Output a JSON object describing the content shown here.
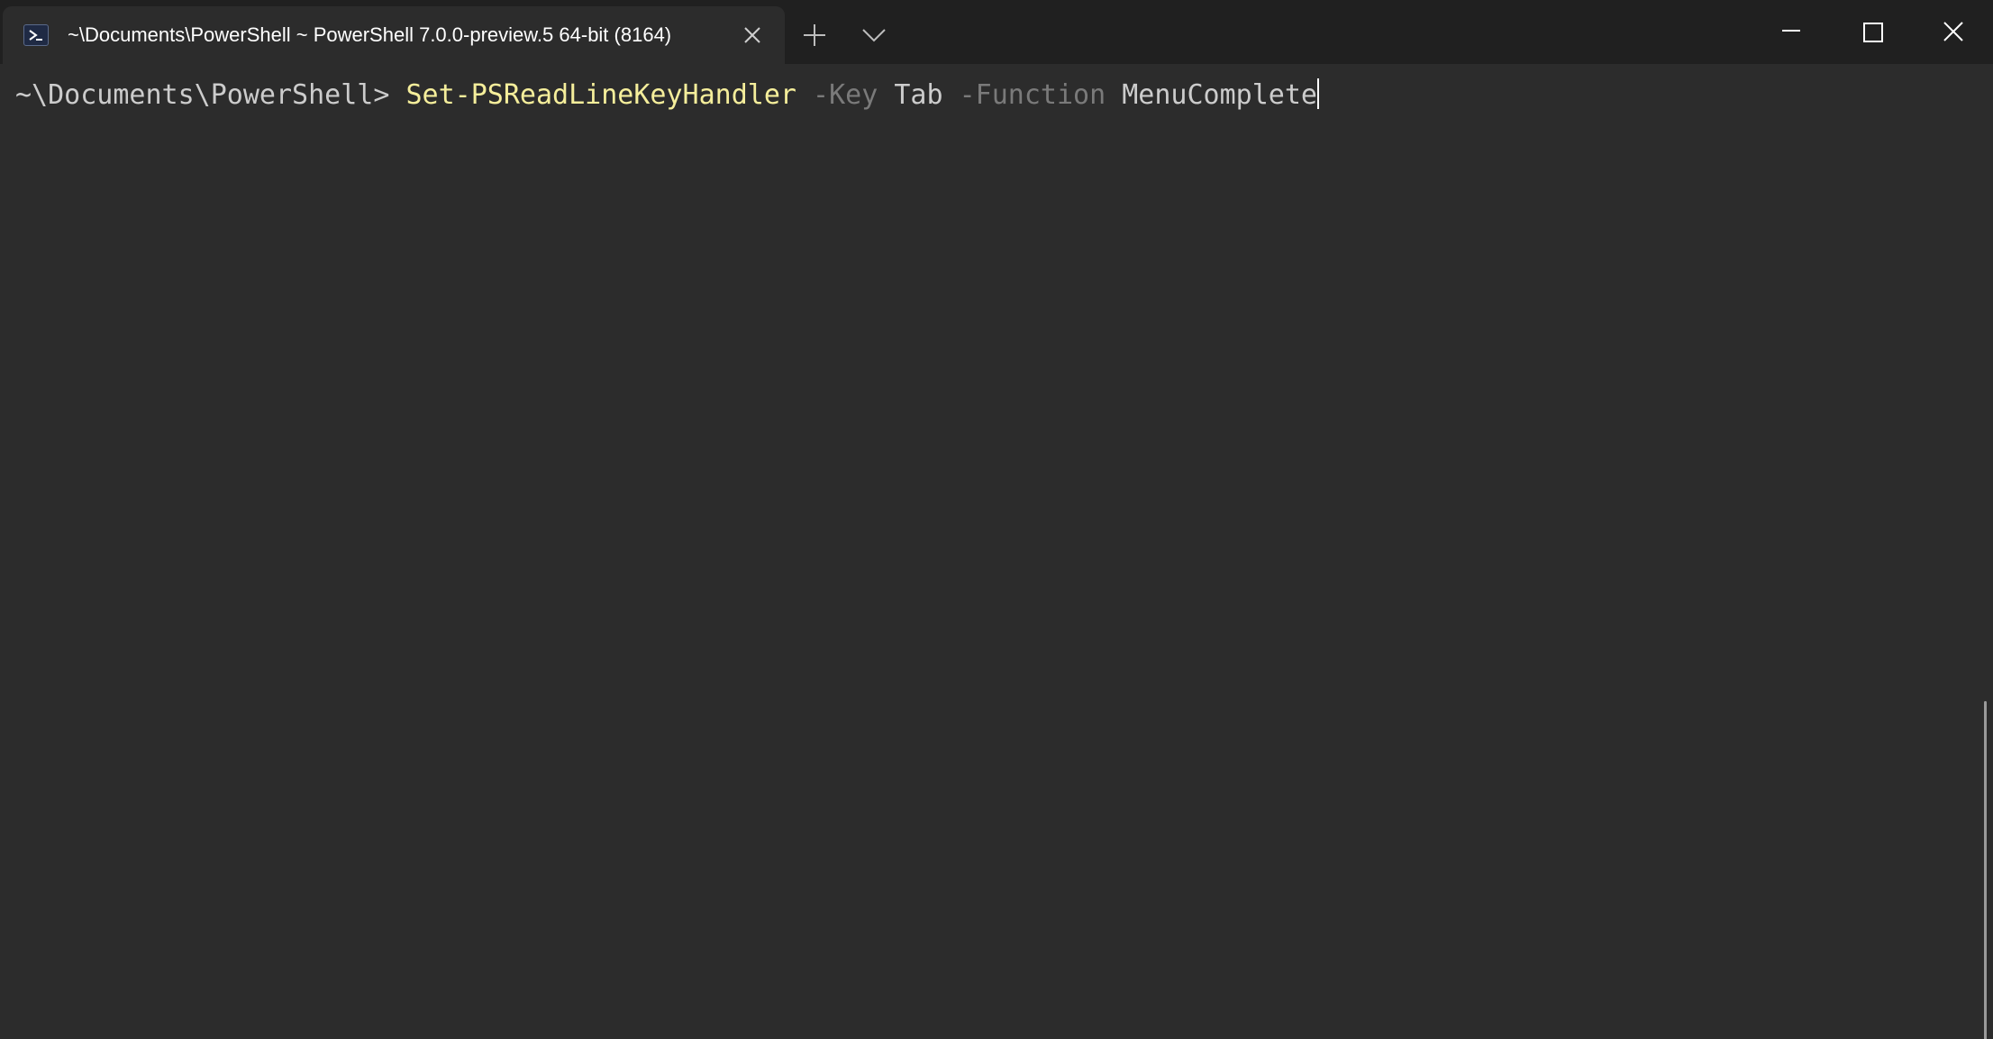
{
  "tab": {
    "icon": "powershell-icon",
    "title": "~\\Documents\\PowerShell ~ PowerShell 7.0.0-preview.5 64-bit (8164)"
  },
  "titlebar": {
    "new_tab_icon": "plus-icon",
    "dropdown_icon": "chevron-down-icon",
    "minimize_icon": "minimize-icon",
    "maximize_icon": "maximize-icon",
    "close_icon": "close-icon"
  },
  "terminal": {
    "prompt": "~\\Documents\\PowerShell> ",
    "cmdlet": "Set-PSReadLineKeyHandler",
    "param1": "-Key",
    "arg1": "Tab",
    "param2": "-Function",
    "arg2": "MenuComplete"
  },
  "colors": {
    "background": "#2c2c2c",
    "titlebar": "#202020",
    "cmdlet": "#f5ee9b",
    "parameter": "#7a7a7a",
    "text": "#cccccc"
  }
}
